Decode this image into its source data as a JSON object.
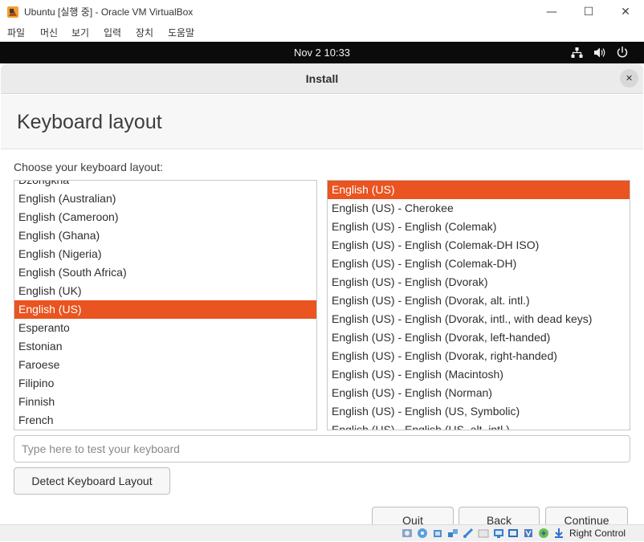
{
  "window": {
    "title": "Ubuntu [실행 중] - Oracle VM VirtualBox",
    "controls": {
      "minimize": "—",
      "maximize": "☐",
      "close": "✕"
    }
  },
  "menu": [
    "파일",
    "머신",
    "보기",
    "입력",
    "장치",
    "도움말"
  ],
  "topbar": {
    "clock": "Nov 2  10:33"
  },
  "installer": {
    "header_title": "Install",
    "close_glyph": "✕",
    "page_title": "Keyboard layout",
    "prompt": "Choose your keyboard layout:",
    "layouts": [
      "Dzongkha",
      "English (Australian)",
      "English (Cameroon)",
      "English (Ghana)",
      "English (Nigeria)",
      "English (South Africa)",
      "English (UK)",
      "English (US)",
      "Esperanto",
      "Estonian",
      "Faroese",
      "Filipino",
      "Finnish",
      "French"
    ],
    "selected_layout": "English (US)",
    "variants": [
      "English (US)",
      "English (US) - Cherokee",
      "English (US) - English (Colemak)",
      "English (US) - English (Colemak-DH ISO)",
      "English (US) - English (Colemak-DH)",
      "English (US) - English (Dvorak)",
      "English (US) - English (Dvorak, alt. intl.)",
      "English (US) - English (Dvorak, intl., with dead keys)",
      "English (US) - English (Dvorak, left-handed)",
      "English (US) - English (Dvorak, right-handed)",
      "English (US) - English (Macintosh)",
      "English (US) - English (Norman)",
      "English (US) - English (US, Symbolic)",
      "English (US) - English (US, alt. intl.)"
    ],
    "selected_variant": "English (US)",
    "test_placeholder": "Type here to test your keyboard",
    "detect_label": "Detect Keyboard Layout",
    "buttons": {
      "quit": "Quit",
      "back": "Back",
      "continue": "Continue"
    },
    "accent_color": "#e95420"
  },
  "statusbar": {
    "host_key": "Right Control",
    "icons": [
      "hard-disk-icon",
      "optical-disk-icon",
      "audio-icon",
      "network-icon",
      "usb-icon",
      "shared-folder-icon",
      "display-icon",
      "video-capture-icon",
      "cpu-icon",
      "mouse-integration-icon",
      "host-key-icon"
    ]
  }
}
